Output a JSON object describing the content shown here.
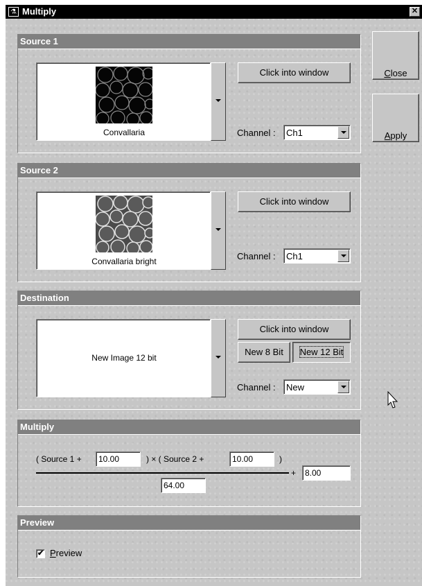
{
  "window": {
    "title": "Multiply",
    "close_glyph": "✕"
  },
  "side": {
    "close_label_u": "C",
    "close_label_rest": "lose",
    "apply_label_u": "A",
    "apply_label_rest": "pply"
  },
  "source1": {
    "header": "Source 1",
    "image_name": "Convallaria",
    "click_button": "Click into window",
    "channel_label": "Channel :",
    "channel_value": "Ch1"
  },
  "source2": {
    "header": "Source 2",
    "image_name": "Convallaria bright",
    "click_button": "Click into window",
    "channel_label": "Channel :",
    "channel_value": "Ch1"
  },
  "destination": {
    "header": "Destination",
    "image_name": "New Image 12 bit",
    "click_button": "Click into window",
    "new8_button": "New 8 Bit",
    "new12_button": "New 12 Bit",
    "channel_label": "Channel :",
    "channel_value": "New"
  },
  "multiply": {
    "header": "Multiply",
    "src1_prefix": "( Source 1  +",
    "src1_offset": "10.00",
    "times_text": ")  ×  ( Source 2  +",
    "src2_offset": "10.00",
    "close_paren": ")",
    "divisor": "64.00",
    "plus_text": "+",
    "add_value": "8.00"
  },
  "preview": {
    "header": "Preview",
    "checkbox_label_u": "P",
    "checkbox_label_rest": "review",
    "checked": true,
    "check_glyph": "✔"
  },
  "colors": {
    "title_bar": "#000000",
    "panel_header": "#808080",
    "window_bg": "#c6c6c6"
  }
}
